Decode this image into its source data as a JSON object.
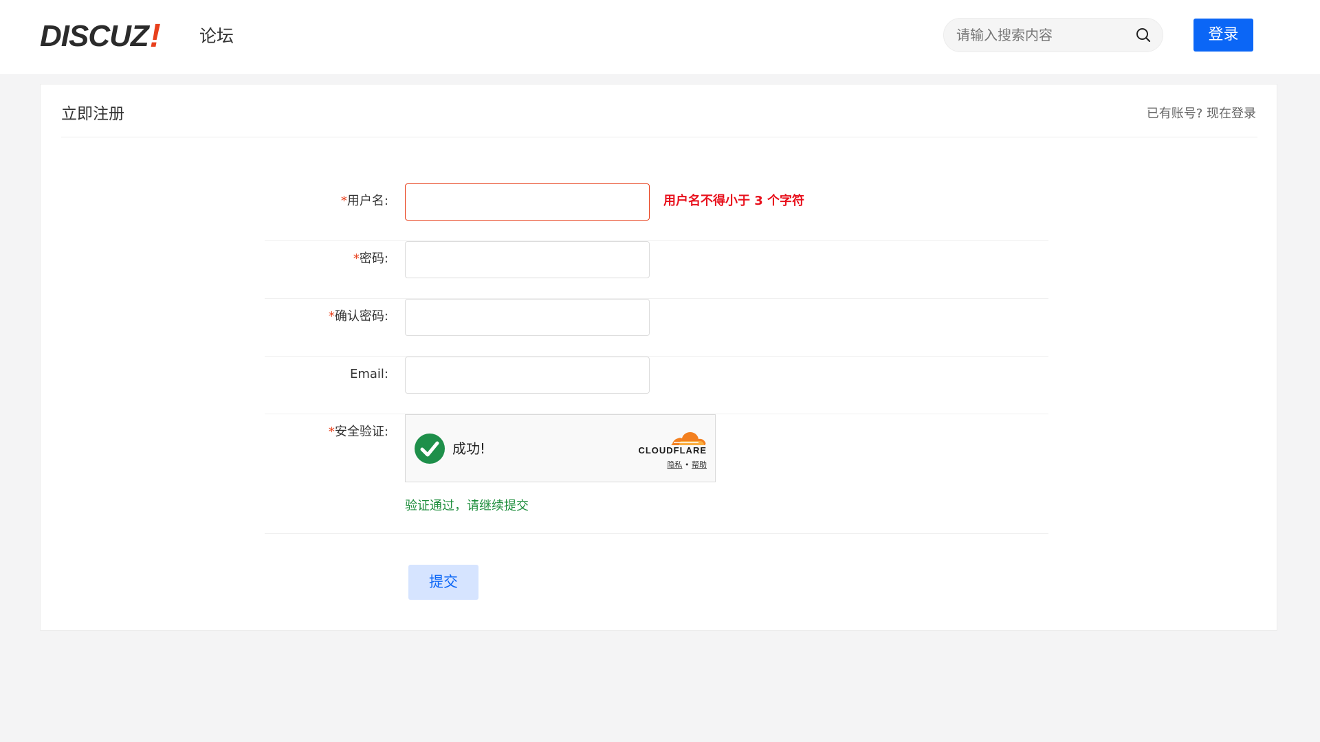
{
  "header": {
    "logo_text": "DISCUZ",
    "logo_bang": "!",
    "logo_sub": "论坛",
    "search_placeholder": "请输入搜索内容",
    "login_label": "登录"
  },
  "card": {
    "title": "立即注册",
    "login_link": "已有账号? 现在登录"
  },
  "form": {
    "required_mark": "*",
    "fields": [
      {
        "label": "用户名:",
        "required": true,
        "value": "",
        "error": "用户名不得小于 3 个字符"
      },
      {
        "label": "密码:",
        "required": true,
        "value": ""
      },
      {
        "label": "确认密码:",
        "required": true,
        "value": ""
      },
      {
        "label": "Email:",
        "required": false,
        "value": ""
      }
    ],
    "captcha": {
      "label": "安全验证:",
      "required": true,
      "status": "成功!",
      "brand": "CLOUDFLARE",
      "privacy": "隐私",
      "separator": "•",
      "help": "帮助",
      "message": "验证通过，请继续提交"
    },
    "submit_label": "提交"
  },
  "colors": {
    "accent": "#0b66f6",
    "error": "#e8101c",
    "success": "#1f8e3d",
    "cloudflare_orange": "#f38020"
  }
}
